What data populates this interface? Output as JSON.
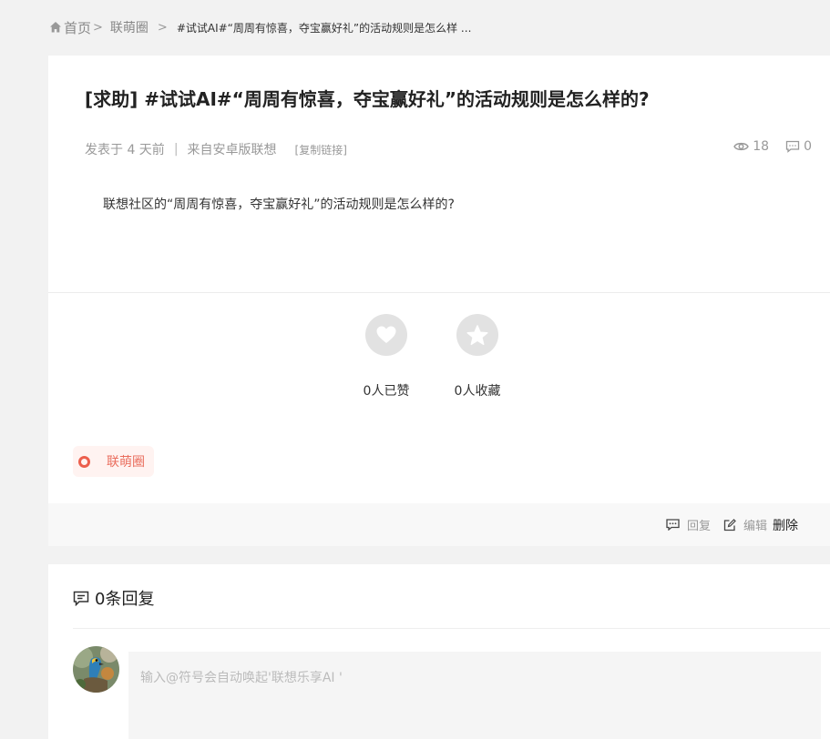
{
  "breadcrumb": {
    "home": "首页",
    "sep": ">",
    "items": [
      "联萌圈"
    ],
    "current": "#试试AI#“周周有惊喜，夺宝赢好礼”的活动规则是怎么样 ..."
  },
  "post": {
    "title": "[求助] #试试AI#“周周有惊喜，夺宝赢好礼”的活动规则是怎么样的?",
    "posted": "发表于 4 天前",
    "divider": "|",
    "source": "来自安卓版联想",
    "copy_link": "[复制链接]",
    "views": "18",
    "comments": "0",
    "body": "联想社区的“周周有惊喜，夺宝赢好礼”的活动规则是怎么样的?",
    "likes": "0人已赞",
    "favorites": "0人收藏",
    "tag": "联萌圈"
  },
  "footer": {
    "reply": "回复",
    "edit": "编辑",
    "delete": "删除"
  },
  "replies": {
    "heading": "0条回复",
    "placeholder": "输入@符号会自动唤起'联想乐享AI '"
  },
  "colors": {
    "accent": "#ec5f4d",
    "tag_bg": "#fff3f1",
    "circle": "#e2e2e2"
  }
}
